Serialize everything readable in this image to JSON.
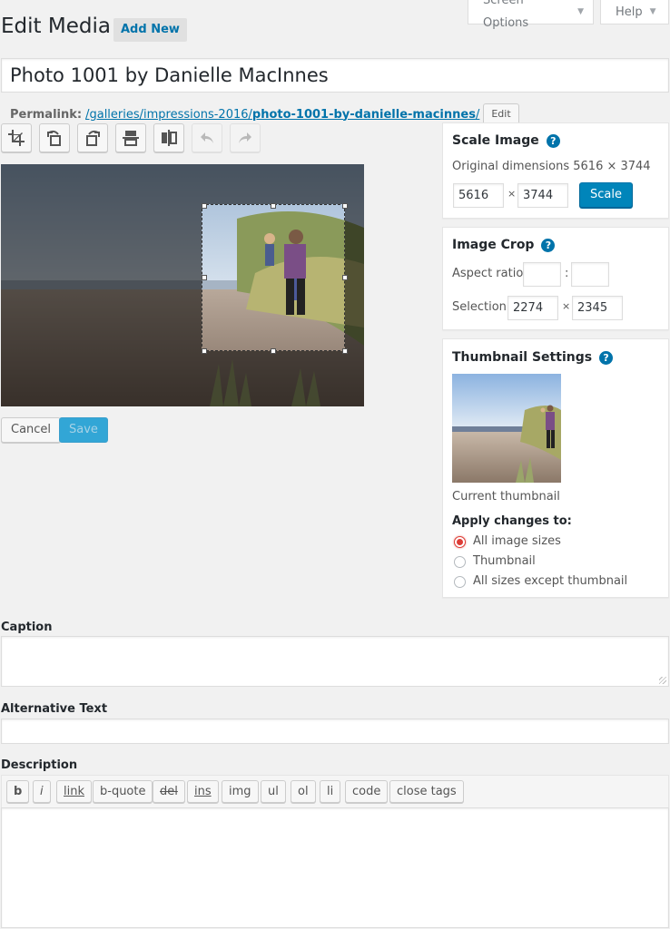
{
  "screen_meta": {
    "screen_options": "Screen Options",
    "help": "Help"
  },
  "header": {
    "title": "Edit Media",
    "add_new": "Add New"
  },
  "post_title": "Photo 1001 by Danielle MacInnes",
  "permalink": {
    "label": "Permalink:",
    "path": "/galleries/impressions-2016/",
    "slug": "photo-1001-by-danielle-macinnes",
    "trail": "/",
    "edit_label": "Edit"
  },
  "toolbar": [
    {
      "name": "crop-button",
      "icon": "crop-icon",
      "disabled": false
    },
    {
      "name": "rotate-left-button",
      "icon": "rotate-left-icon",
      "disabled": false
    },
    {
      "name": "rotate-right-button",
      "icon": "rotate-right-icon",
      "disabled": false
    },
    {
      "name": "flip-vertical-button",
      "icon": "flip-vertical-icon",
      "disabled": false
    },
    {
      "name": "flip-horizontal-button",
      "icon": "flip-horizontal-icon",
      "disabled": false
    },
    {
      "name": "undo-button",
      "icon": "undo-icon",
      "disabled": true
    },
    {
      "name": "redo-button",
      "icon": "redo-icon",
      "disabled": true
    }
  ],
  "editor_actions": {
    "cancel": "Cancel",
    "save": "Save"
  },
  "scale_image": {
    "title": "Scale Image",
    "original_dimensions": "Original dimensions 5616 × 3744",
    "width": "5616",
    "height": "3744",
    "times": "×",
    "scale_button": "Scale"
  },
  "image_crop": {
    "title": "Image Crop",
    "aspect_label": "Aspect ratio:",
    "aspect_sep": ":",
    "aspect_w": "",
    "aspect_h": "",
    "selection_label": "Selection:",
    "selection_w": "2274",
    "selection_h": "2345",
    "times": "×"
  },
  "thumbnail": {
    "title": "Thumbnail Settings",
    "current_label": "Current thumbnail",
    "apply_label": "Apply changes to:",
    "options": [
      "All image sizes",
      "Thumbnail",
      "All sizes except thumbnail"
    ],
    "selected_index": 0
  },
  "caption": {
    "label": "Caption",
    "value": ""
  },
  "alt_text": {
    "label": "Alternative Text",
    "value": ""
  },
  "description": {
    "label": "Description",
    "quicktags": [
      "b",
      "i",
      "link",
      "b-quote",
      "del",
      "ins",
      "img",
      "ul",
      "ol",
      "li",
      "code",
      "close tags"
    ],
    "value": ""
  },
  "colors": {
    "accent": "#0073aa",
    "primary_button": "#0085ba",
    "radio_checked": "#dd3d36"
  }
}
